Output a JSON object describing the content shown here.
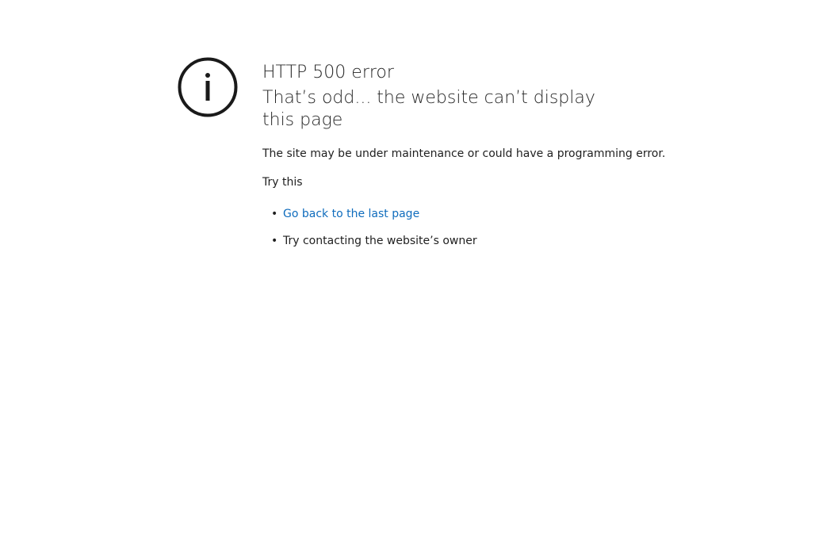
{
  "icon": "info-circle-icon",
  "colors": {
    "link": "#0f6cbd",
    "text": "#1f1f1f",
    "icon": "#1a1a1a"
  },
  "error": {
    "code_title": "HTTP 500 error",
    "headline": "That’s odd... the website can’t display this page",
    "description": "The site may be under maintenance or could have a programming error.",
    "try_label": "Try this"
  },
  "suggestions": [
    {
      "text": "Go back to the last page",
      "is_link": true
    },
    {
      "text": "Try contacting the website’s owner",
      "is_link": false
    }
  ]
}
